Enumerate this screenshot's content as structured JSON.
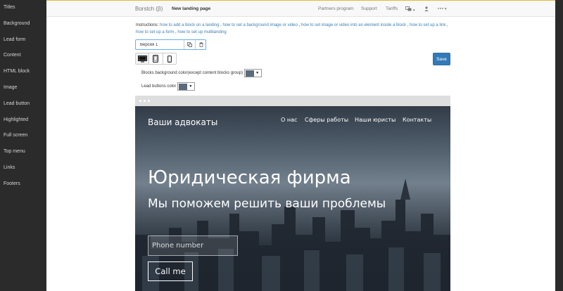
{
  "sidebar": {
    "items": [
      "Titles",
      "Background",
      "Lead form",
      "Content",
      "HTML block",
      "Image",
      "Lead button",
      "Highlighted",
      "Full screen",
      "Top menu",
      "Links",
      "Footers"
    ]
  },
  "topbar": {
    "brand": "Borstch (β)",
    "page_name": "New landing page",
    "links": {
      "partners": "Partners program",
      "support": "Support",
      "tariffs": "Tariffs"
    },
    "menu_icons": [
      "language-icon",
      "user-icon",
      "more-icon"
    ]
  },
  "instructions": {
    "label": "Instructions",
    "links": [
      "how to add a block on a landing",
      "how to set a background image or video",
      "how to set image or video into an element inside a block",
      "how to set up a link",
      "how to set up a form",
      "how to set up multilanding"
    ]
  },
  "version": {
    "value": "Версия 1",
    "icons": [
      "copy-icon",
      "trash-icon"
    ]
  },
  "devices": {
    "active": "desktop",
    "icons": [
      "desktop-icon",
      "tablet-icon",
      "mobile-icon"
    ]
  },
  "save_label": "Save",
  "colors": {
    "blocks_bg_label": "Blocks background color(except content blocks group)",
    "blocks_bg_value": "#5b6b7c",
    "lead_buttons_label": "Lead buttons color",
    "lead_buttons_value": "#5b6b7c"
  },
  "accent_color": "#e6b73d",
  "preview": {
    "brand": "Ваши адвокаты",
    "nav": [
      "О нас",
      "Сферы работы",
      "Наши юристы",
      "Контакты"
    ],
    "title": "Юридическая фирма",
    "subtitle": "Мы поможем решить ваши проблемы",
    "phone_placeholder": "Phone number",
    "call_label": "Call me"
  }
}
